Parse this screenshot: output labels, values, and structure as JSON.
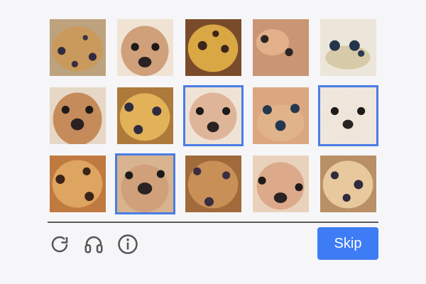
{
  "captcha": {
    "tiles": [
      {
        "label": "muffin",
        "selected": false
      },
      {
        "label": "chihuahua",
        "selected": false
      },
      {
        "label": "muffin",
        "selected": false
      },
      {
        "label": "chihuahua",
        "selected": false
      },
      {
        "label": "muffin",
        "selected": false
      },
      {
        "label": "chihuahua",
        "selected": false
      },
      {
        "label": "muffin",
        "selected": false
      },
      {
        "label": "chihuahua",
        "selected": true
      },
      {
        "label": "muffin",
        "selected": false
      },
      {
        "label": "chihuahua",
        "selected": true
      },
      {
        "label": "muffin",
        "selected": false
      },
      {
        "label": "chihuahua",
        "selected": true
      },
      {
        "label": "muffin",
        "selected": false
      },
      {
        "label": "chihuahua",
        "selected": false
      },
      {
        "label": "muffin",
        "selected": false
      }
    ],
    "controls": {
      "reload_icon": "reload-icon",
      "audio_icon": "headphones-icon",
      "info_icon": "info-icon"
    },
    "skip_label": "Skip",
    "colors": {
      "accent": "#3d7cf4",
      "selection_border": "#4a7de6",
      "divider": "#5b5b5b"
    }
  }
}
